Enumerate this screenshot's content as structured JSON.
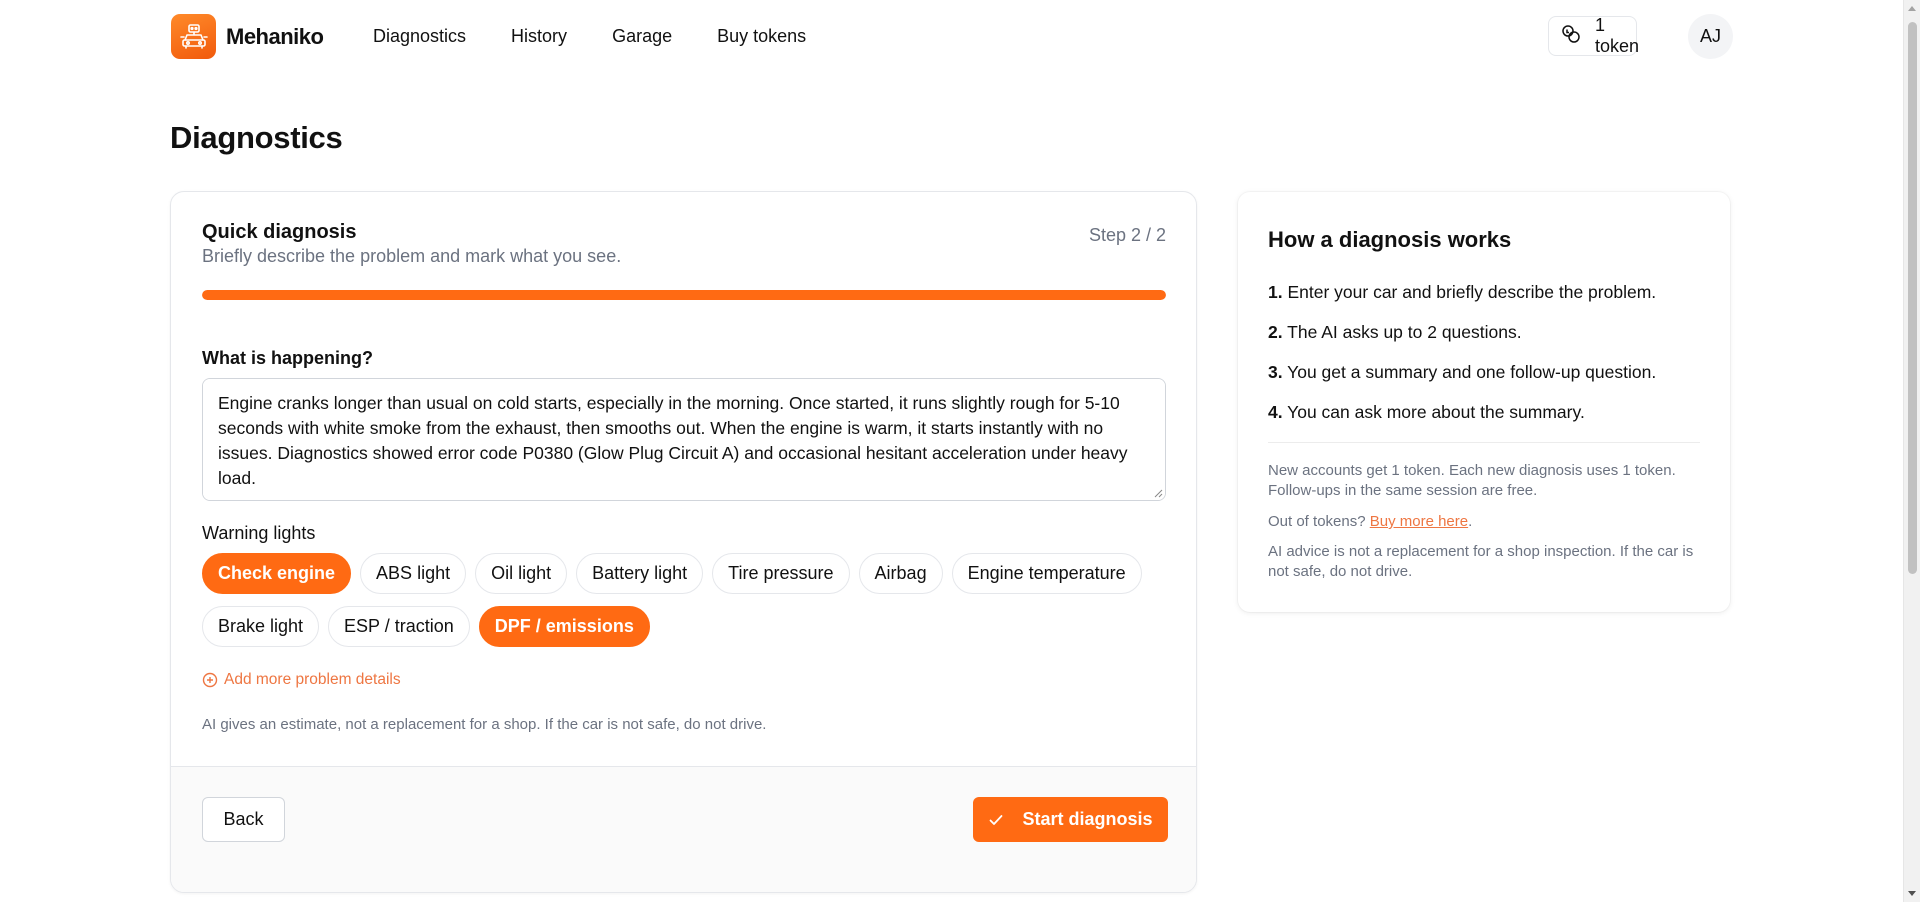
{
  "app": {
    "brand_name": "Mehaniko",
    "accent_color": "#ff6a13"
  },
  "nav": {
    "items": [
      {
        "label": "Diagnostics"
      },
      {
        "label": "History"
      },
      {
        "label": "Garage"
      },
      {
        "label": "Buy tokens"
      }
    ],
    "token_label": "1 token",
    "token_icon": "coins-icon",
    "avatar_initials": "AJ"
  },
  "page": {
    "title": "Diagnostics"
  },
  "form": {
    "title": "Quick diagnosis",
    "subtitle": "Briefly describe the problem and mark what you see.",
    "step_label": "Step 2 / 2",
    "progress": 1.0,
    "what_label": "What is happening?",
    "description": "Engine cranks longer than usual on cold starts, especially in the morning. Once started, it runs slightly rough for 5-10 seconds with white smoke from the exhaust, then smooths out. When the engine is warm, it starts instantly with no issues. Diagnostics showed error code P0380 (Glow Plug Circuit A) and occasional hesitant acceleration under heavy load.",
    "warning_label": "Warning lights",
    "warning_lights": [
      {
        "label": "Check engine",
        "selected": true
      },
      {
        "label": "ABS light",
        "selected": false
      },
      {
        "label": "Oil light",
        "selected": false
      },
      {
        "label": "Battery light",
        "selected": false
      },
      {
        "label": "Tire pressure",
        "selected": false
      },
      {
        "label": "Airbag",
        "selected": false
      },
      {
        "label": "Engine temperature",
        "selected": false
      },
      {
        "label": "Brake light",
        "selected": false
      },
      {
        "label": "ESP / traction",
        "selected": false
      },
      {
        "label": "DPF / emissions",
        "selected": true
      }
    ],
    "add_more_label": "Add more problem details",
    "disclaimer": "AI gives an estimate, not a replacement for a shop. If the car is not safe, do not drive.",
    "back_label": "Back",
    "start_label": "Start diagnosis"
  },
  "howto": {
    "title": "How a diagnosis works",
    "steps": [
      {
        "num": "1.",
        "text": "Enter your car and briefly describe the problem."
      },
      {
        "num": "2.",
        "text": "The AI asks up to 2 questions."
      },
      {
        "num": "3.",
        "text": "You get a summary and one follow-up question."
      },
      {
        "num": "4.",
        "text": "You can ask more about the summary."
      }
    ],
    "note_tokens": "New accounts get 1 token. Each new diagnosis uses 1 token. Follow-ups in the same session are free.",
    "out_of_tokens": "Out of tokens?",
    "buy_more_link": "Buy more here",
    "period": ".",
    "note_advice": "AI advice is not a replacement for a shop inspection. If the car is not safe, do not drive."
  }
}
